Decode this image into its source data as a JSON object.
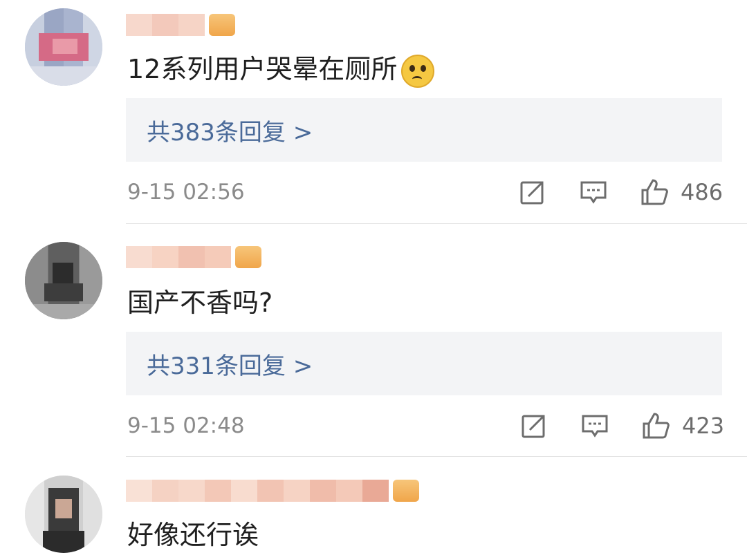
{
  "comments": [
    {
      "text": "12系列用户哭晕在厕所",
      "has_emoji": true,
      "emoji_name": "crying-face-icon",
      "replies": "共383条回复 >",
      "time": "9-15 02:56",
      "likes": "486"
    },
    {
      "text": "国产不香吗?",
      "has_emoji": false,
      "replies": "共331条回复 >",
      "time": "9-15 02:48",
      "likes": "423"
    },
    {
      "text": "好像还行诶",
      "has_emoji": false
    }
  ],
  "colors": {
    "reply_link": "#4a6a99",
    "reply_bg": "#f3f4f6",
    "meta_text": "#8b8b8b",
    "badge": "#f0a64a"
  }
}
